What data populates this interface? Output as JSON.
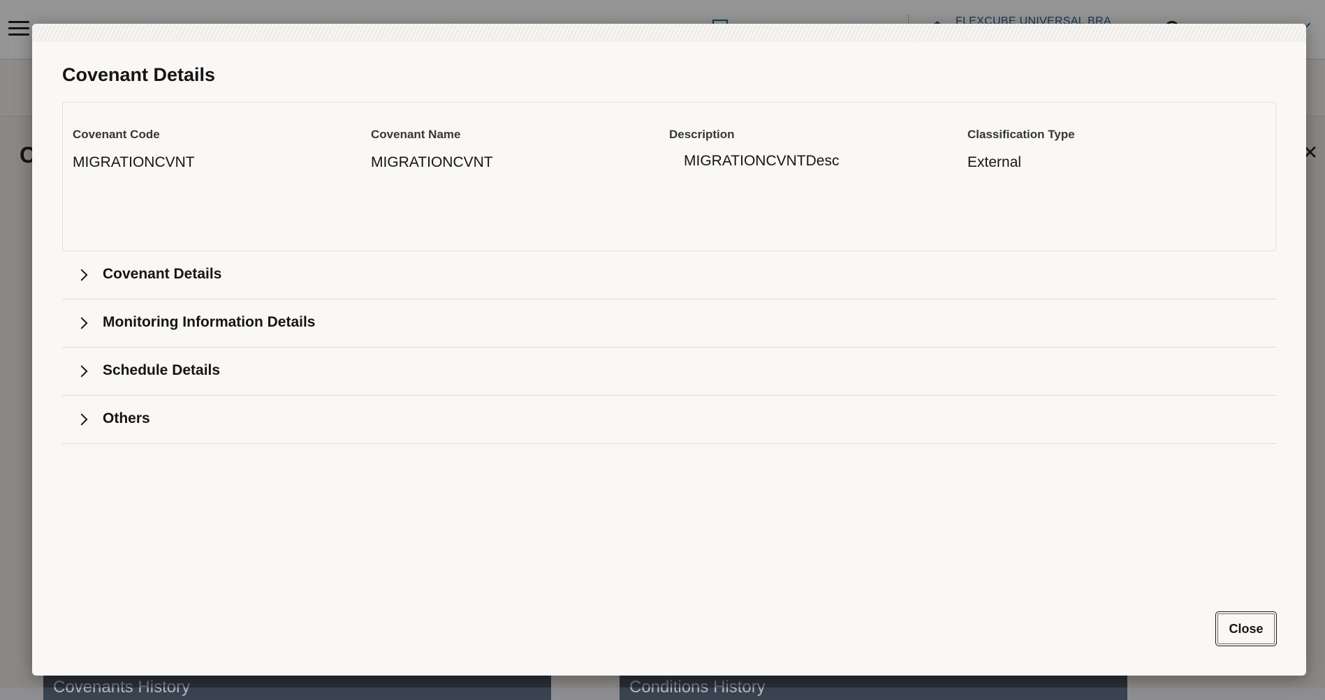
{
  "background": {
    "product_name": "FLEXCUBE UNIVERSAL BRA",
    "page_title_initial": "C",
    "cards": [
      "Covenants History",
      "Conditions History"
    ]
  },
  "modal": {
    "title": "Covenant Details",
    "fields": [
      {
        "label": "Covenant Code",
        "value": "MIGRATIONCVNT"
      },
      {
        "label": "Covenant Name",
        "value": "MIGRATIONCVNT"
      },
      {
        "label": "Description",
        "value": "MIGRATIONCVNTDesc"
      },
      {
        "label": "Classification Type",
        "value": "External"
      }
    ],
    "sections": [
      {
        "label": "Covenant Details",
        "icon": "chevron-right-icon"
      },
      {
        "label": "Monitoring Information Details",
        "icon": "chevron-right-icon"
      },
      {
        "label": "Schedule Details",
        "icon": "chevron-right-icon"
      },
      {
        "label": "Others",
        "icon": "chevron-right-icon"
      }
    ],
    "close_label": "Close"
  }
}
